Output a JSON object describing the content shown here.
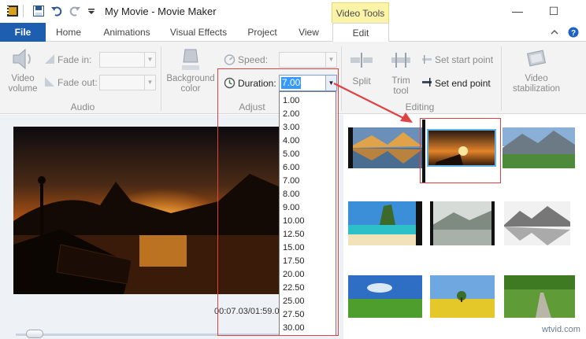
{
  "app": {
    "title": "My Movie - Movie Maker",
    "contextual_tab": "Video Tools"
  },
  "tabs": [
    "File",
    "Home",
    "Animations",
    "Visual Effects",
    "Project",
    "View",
    "Edit"
  ],
  "ribbon": {
    "audio": {
      "group_label": "Audio",
      "video_volume_label": "Video\nvolume",
      "fade_in_label": "Fade in:",
      "fade_out_label": "Fade out:",
      "fade_in_value": "",
      "fade_out_value": ""
    },
    "adjust": {
      "group_label": "Adjust",
      "background_color_label": "Background\ncolor",
      "speed_label": "Speed:",
      "speed_value": "",
      "duration_label": "Duration:",
      "duration_value": "7.00"
    },
    "editing": {
      "group_label": "Editing",
      "split_label": "Split",
      "trim_tool_label": "Trim\ntool",
      "set_start_point_label": "Set start point",
      "set_end_point_label": "Set end point"
    },
    "stabilization": {
      "video_stabilization_label": "Video\nstabilization"
    }
  },
  "duration_options": [
    "1.00",
    "2.00",
    "3.00",
    "4.00",
    "5.00",
    "6.00",
    "7.00",
    "8.00",
    "9.00",
    "10.00",
    "12.50",
    "15.00",
    "17.50",
    "20.00",
    "22.50",
    "25.00",
    "27.50",
    "30.00"
  ],
  "preview": {
    "timecode": "00:07.03/01:59.0",
    "seek_position": 0.06
  },
  "watermark": "wtvid.com",
  "colors": {
    "file_tab": "#1e5eb0",
    "contextual_tab": "#fbf4a8",
    "annotation": "#e04141",
    "selection": "#3399ff"
  }
}
